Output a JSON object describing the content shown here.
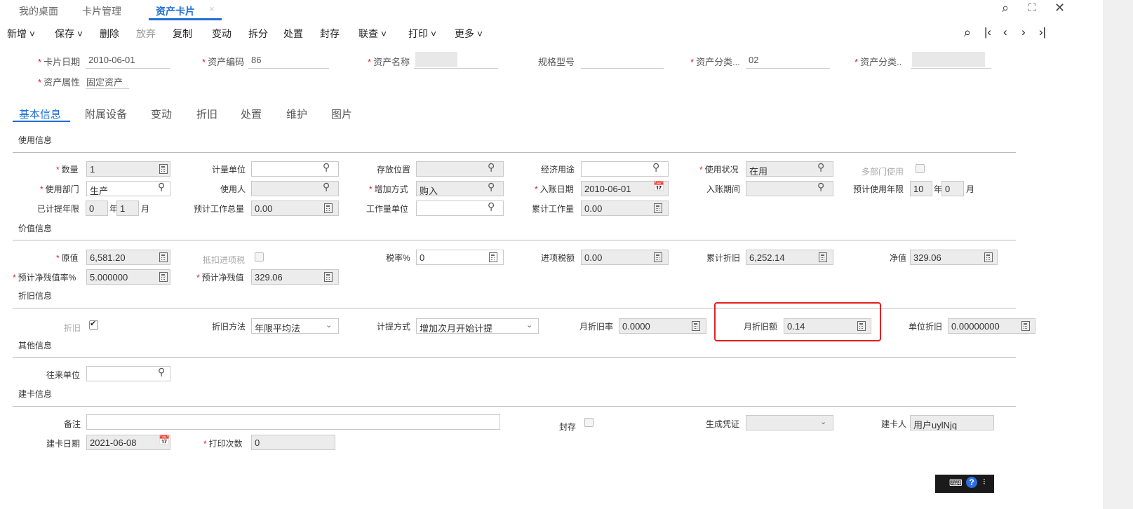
{
  "tabs": [
    {
      "label": "我的桌面"
    },
    {
      "label": "卡片管理"
    },
    {
      "label": "资产卡片",
      "close": "×"
    }
  ],
  "toolbar": {
    "add": "新增 ˅",
    "save": "保存 ˅",
    "delete": "删除",
    "discard": "放弃",
    "copy": "复制",
    "change": "变动",
    "split": "拆分",
    "dispose": "处置",
    "seal": "封存",
    "link": "联查 ˅",
    "print": "打印 ˅",
    "more": "更多 ˅"
  },
  "nav": {
    "first": "|‹",
    "prev": "‹",
    "next": "›",
    "last": "›|"
  },
  "header": {
    "card_date_label": "卡片日期",
    "card_date": "2010-06-01",
    "asset_code_label": "资产编码",
    "asset_code": "86",
    "asset_name_label": "资产名称",
    "spec_label": "规格型号",
    "asset_cat1_label": "资产分类...",
    "asset_cat1": "02",
    "asset_cat2_label": "资产分类..",
    "asset_attr_label": "资产属性",
    "asset_attr": "固定资产"
  },
  "detail_tabs": [
    "基本信息",
    "附属设备",
    "变动",
    "折旧",
    "处置",
    "维护",
    "图片"
  ],
  "sections": {
    "usage": "使用信息",
    "value": "价值信息",
    "depreciation": "折旧信息",
    "other": "其他信息",
    "card": "建卡信息"
  },
  "usage": {
    "qty_label": "数量",
    "qty": "1",
    "unit_label": "计量单位",
    "location_label": "存放位置",
    "purpose_label": "经济用途",
    "status_label": "使用状况",
    "status": "在用",
    "multi_dept_label": "多部门使用",
    "dept_label": "使用部门",
    "dept": "生产",
    "user_label": "使用人",
    "add_method_label": "增加方式",
    "add_method": "购入",
    "entry_date_label": "入账日期",
    "entry_date": "2010-06-01",
    "entry_period_label": "入账期间",
    "life_label": "预计使用年限",
    "life_years": "10",
    "year_unit": "年",
    "life_months": "0",
    "month_unit": "月",
    "used_label": "已计提年限",
    "used_years": "0",
    "used_months": "1",
    "workload_label": "预计工作总量",
    "workload": "0.00",
    "work_unit_label": "工作量单位",
    "cum_work_label": "累计工作量",
    "cum_work": "0.00"
  },
  "value": {
    "original_label": "原值",
    "original": "6,581.20",
    "deduct_tax_label": "抵扣进项税",
    "tax_rate_label": "税率%",
    "tax_rate": "0",
    "input_tax_label": "进项税额",
    "input_tax": "0.00",
    "cum_dep_label": "累计折旧",
    "cum_dep": "6,252.14",
    "net_label": "净值",
    "net": "329.06",
    "residual_rate_label": "预计净残值率%",
    "residual_rate": "5.000000",
    "residual_label": "预计净残值",
    "residual": "329.06"
  },
  "depreciation": {
    "dep_label": "折旧",
    "method_label": "折旧方法",
    "method": "年限平均法",
    "accrual_label": "计提方式",
    "accrual": "增加次月开始计提",
    "monthly_rate_label": "月折旧率",
    "monthly_rate": "0.0000",
    "monthly_amount_label": "月折旧额",
    "monthly_amount": "0.14",
    "unit_dep_label": "单位折旧",
    "unit_dep": "0.00000000"
  },
  "other": {
    "partner_label": "往来单位"
  },
  "card": {
    "remark_label": "备注",
    "sealed_label": "封存",
    "voucher_label": "生成凭证",
    "creator_label": "建卡人",
    "creator": "用户uylNjq",
    "card_date_label": "建卡日期",
    "card_date": "2021-06-08",
    "print_count_label": "打印次数",
    "print_count": "0"
  },
  "icons": {
    "search": "search-icon",
    "calculator": "calculator-icon",
    "calendar": "calendar-icon",
    "highlight_color": "#e02020",
    "accent": "#1e6fd6"
  }
}
